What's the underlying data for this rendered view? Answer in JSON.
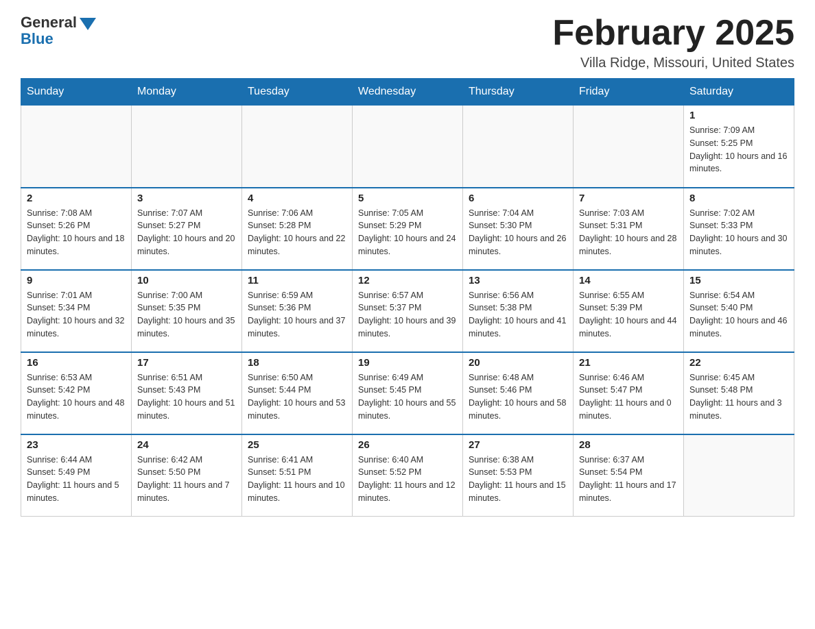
{
  "logo": {
    "general": "General",
    "blue": "Blue"
  },
  "title": {
    "month_year": "February 2025",
    "location": "Villa Ridge, Missouri, United States"
  },
  "weekdays": [
    "Sunday",
    "Monday",
    "Tuesday",
    "Wednesday",
    "Thursday",
    "Friday",
    "Saturday"
  ],
  "weeks": [
    [
      {
        "day": "",
        "info": ""
      },
      {
        "day": "",
        "info": ""
      },
      {
        "day": "",
        "info": ""
      },
      {
        "day": "",
        "info": ""
      },
      {
        "day": "",
        "info": ""
      },
      {
        "day": "",
        "info": ""
      },
      {
        "day": "1",
        "info": "Sunrise: 7:09 AM\nSunset: 5:25 PM\nDaylight: 10 hours and 16 minutes."
      }
    ],
    [
      {
        "day": "2",
        "info": "Sunrise: 7:08 AM\nSunset: 5:26 PM\nDaylight: 10 hours and 18 minutes."
      },
      {
        "day": "3",
        "info": "Sunrise: 7:07 AM\nSunset: 5:27 PM\nDaylight: 10 hours and 20 minutes."
      },
      {
        "day": "4",
        "info": "Sunrise: 7:06 AM\nSunset: 5:28 PM\nDaylight: 10 hours and 22 minutes."
      },
      {
        "day": "5",
        "info": "Sunrise: 7:05 AM\nSunset: 5:29 PM\nDaylight: 10 hours and 24 minutes."
      },
      {
        "day": "6",
        "info": "Sunrise: 7:04 AM\nSunset: 5:30 PM\nDaylight: 10 hours and 26 minutes."
      },
      {
        "day": "7",
        "info": "Sunrise: 7:03 AM\nSunset: 5:31 PM\nDaylight: 10 hours and 28 minutes."
      },
      {
        "day": "8",
        "info": "Sunrise: 7:02 AM\nSunset: 5:33 PM\nDaylight: 10 hours and 30 minutes."
      }
    ],
    [
      {
        "day": "9",
        "info": "Sunrise: 7:01 AM\nSunset: 5:34 PM\nDaylight: 10 hours and 32 minutes."
      },
      {
        "day": "10",
        "info": "Sunrise: 7:00 AM\nSunset: 5:35 PM\nDaylight: 10 hours and 35 minutes."
      },
      {
        "day": "11",
        "info": "Sunrise: 6:59 AM\nSunset: 5:36 PM\nDaylight: 10 hours and 37 minutes."
      },
      {
        "day": "12",
        "info": "Sunrise: 6:57 AM\nSunset: 5:37 PM\nDaylight: 10 hours and 39 minutes."
      },
      {
        "day": "13",
        "info": "Sunrise: 6:56 AM\nSunset: 5:38 PM\nDaylight: 10 hours and 41 minutes."
      },
      {
        "day": "14",
        "info": "Sunrise: 6:55 AM\nSunset: 5:39 PM\nDaylight: 10 hours and 44 minutes."
      },
      {
        "day": "15",
        "info": "Sunrise: 6:54 AM\nSunset: 5:40 PM\nDaylight: 10 hours and 46 minutes."
      }
    ],
    [
      {
        "day": "16",
        "info": "Sunrise: 6:53 AM\nSunset: 5:42 PM\nDaylight: 10 hours and 48 minutes."
      },
      {
        "day": "17",
        "info": "Sunrise: 6:51 AM\nSunset: 5:43 PM\nDaylight: 10 hours and 51 minutes."
      },
      {
        "day": "18",
        "info": "Sunrise: 6:50 AM\nSunset: 5:44 PM\nDaylight: 10 hours and 53 minutes."
      },
      {
        "day": "19",
        "info": "Sunrise: 6:49 AM\nSunset: 5:45 PM\nDaylight: 10 hours and 55 minutes."
      },
      {
        "day": "20",
        "info": "Sunrise: 6:48 AM\nSunset: 5:46 PM\nDaylight: 10 hours and 58 minutes."
      },
      {
        "day": "21",
        "info": "Sunrise: 6:46 AM\nSunset: 5:47 PM\nDaylight: 11 hours and 0 minutes."
      },
      {
        "day": "22",
        "info": "Sunrise: 6:45 AM\nSunset: 5:48 PM\nDaylight: 11 hours and 3 minutes."
      }
    ],
    [
      {
        "day": "23",
        "info": "Sunrise: 6:44 AM\nSunset: 5:49 PM\nDaylight: 11 hours and 5 minutes."
      },
      {
        "day": "24",
        "info": "Sunrise: 6:42 AM\nSunset: 5:50 PM\nDaylight: 11 hours and 7 minutes."
      },
      {
        "day": "25",
        "info": "Sunrise: 6:41 AM\nSunset: 5:51 PM\nDaylight: 11 hours and 10 minutes."
      },
      {
        "day": "26",
        "info": "Sunrise: 6:40 AM\nSunset: 5:52 PM\nDaylight: 11 hours and 12 minutes."
      },
      {
        "day": "27",
        "info": "Sunrise: 6:38 AM\nSunset: 5:53 PM\nDaylight: 11 hours and 15 minutes."
      },
      {
        "day": "28",
        "info": "Sunrise: 6:37 AM\nSunset: 5:54 PM\nDaylight: 11 hours and 17 minutes."
      },
      {
        "day": "",
        "info": ""
      }
    ]
  ]
}
